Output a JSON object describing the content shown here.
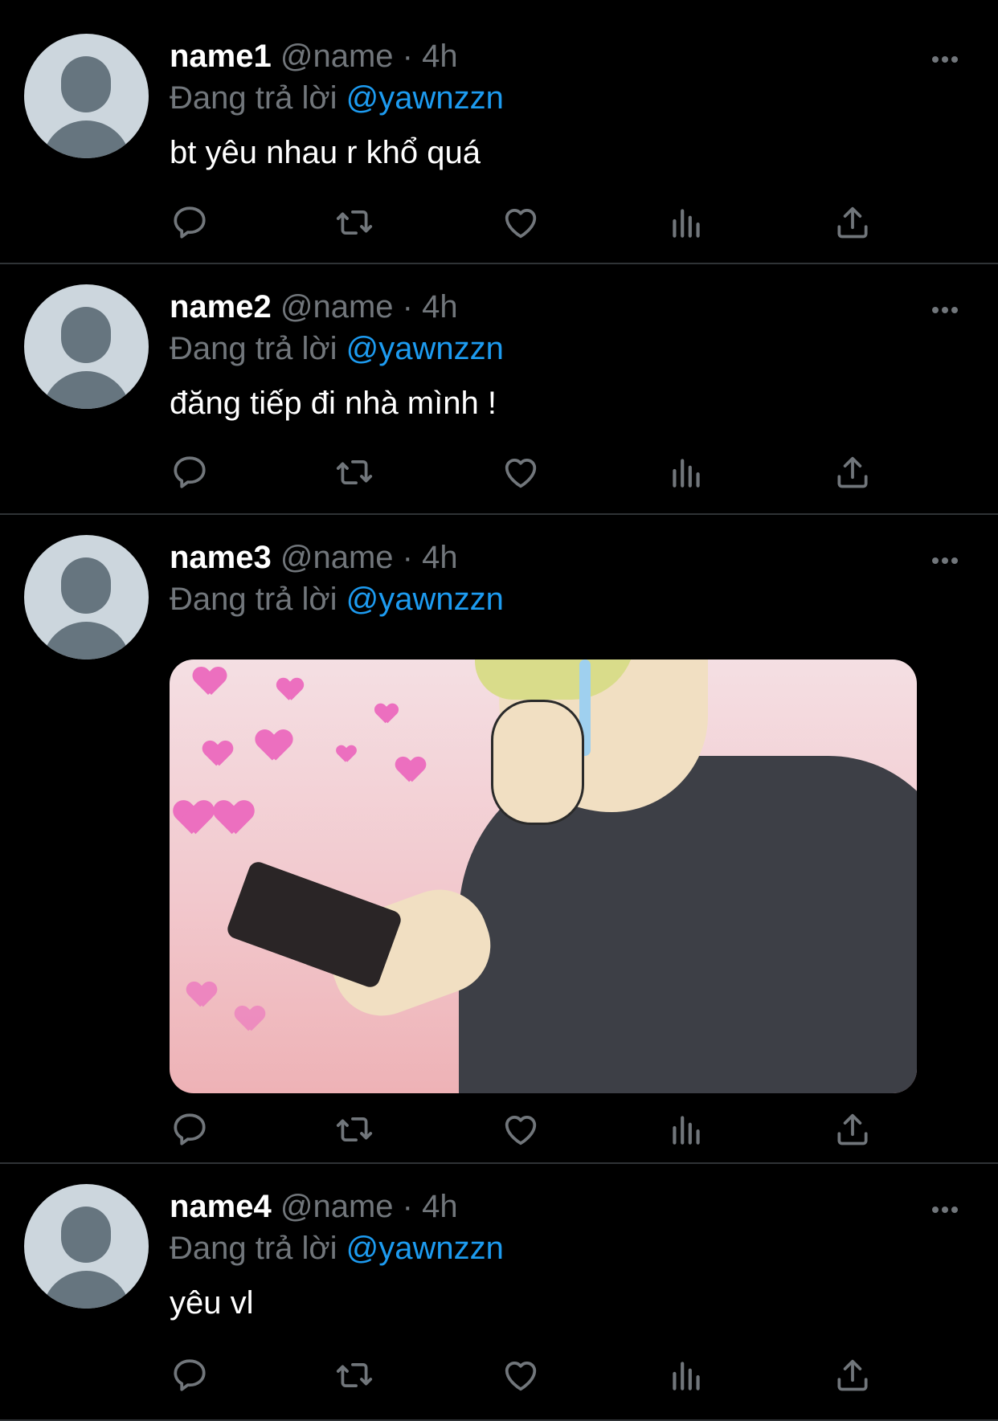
{
  "tweets": [
    {
      "name": "name1",
      "handle": "@name",
      "separator": "·",
      "time": "4h",
      "reply_prefix": "Đang trả lời",
      "reply_to": "@yawnzzn",
      "text": "bt yêu nhau r khổ quá"
    },
    {
      "name": "name2",
      "handle": "@name",
      "separator": "·",
      "time": "4h",
      "reply_prefix": "Đang trả lời",
      "reply_to": "@yawnzzn",
      "text": "đăng tiếp đi nhà mình !"
    },
    {
      "name": "name3",
      "handle": "@name",
      "separator": "·",
      "time": "4h",
      "reply_prefix": "Đang trả lời",
      "reply_to": "@yawnzzn",
      "text": "",
      "media": "anime-image"
    },
    {
      "name": "name4",
      "handle": "@name",
      "separator": "·",
      "time": "4h",
      "reply_prefix": "Đang trả lời",
      "reply_to": "@yawnzzn",
      "text": "yêu vl"
    }
  ],
  "icons": {
    "reply": "reply-icon",
    "retweet": "retweet-icon",
    "like": "heart-icon",
    "views": "views-icon",
    "share": "share-icon",
    "more": "more-icon"
  },
  "colors": {
    "background": "#000000",
    "text": "#ffffff",
    "secondary": "#71767b",
    "accent": "#1d9bf0",
    "divider": "#2f3336",
    "avatar_bg": "#ccd6dd",
    "avatar_fg": "#66757f"
  }
}
